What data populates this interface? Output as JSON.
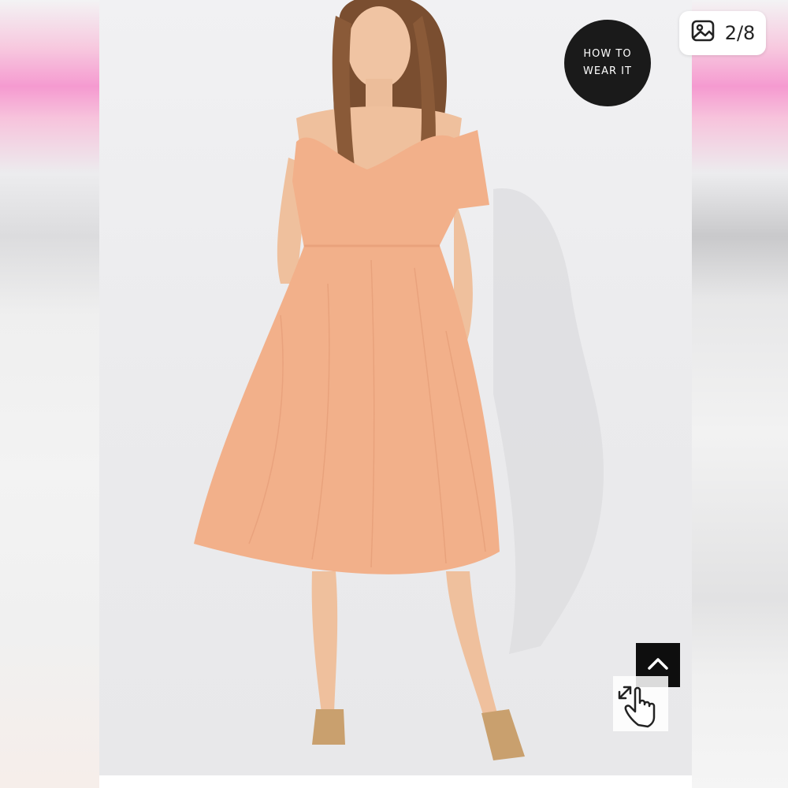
{
  "gallery": {
    "counter": "2/8",
    "icons": {
      "counter": "image-icon",
      "scroll_top": "chevron-up-icon",
      "zoom": "expand-hand-icon"
    },
    "badge_lines": [
      "HOW TO",
      "WEAR IT"
    ],
    "dress_color": "#f2b08a",
    "badge_color": "#1a1a1a"
  }
}
